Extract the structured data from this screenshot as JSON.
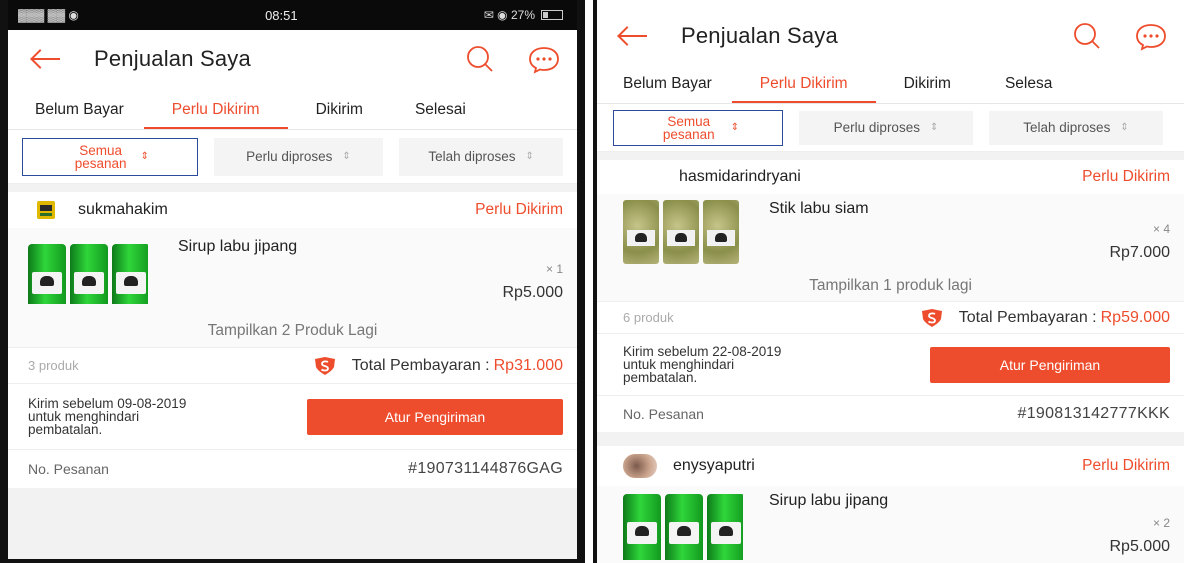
{
  "colors": {
    "accent": "#ee4d2d",
    "selected_border": "#2b4c9c"
  },
  "status_bar": {
    "left": "▓▓▓ ▓▓ ◉",
    "time": "08:51",
    "right": "✉ ◉ 27%"
  },
  "screens": [
    {
      "header": {
        "title": "Penjualan Saya",
        "icons": [
          "back-arrow-icon",
          "search-icon",
          "chat-icon"
        ]
      },
      "tabs": [
        "Belum Bayar",
        "Perlu Dikirim",
        "Dikirim",
        "Selesai"
      ],
      "active_tab": "Perlu Dikirim",
      "filters": [
        "Semua pesanan",
        "Perlu diproses",
        "Telah diproses"
      ],
      "orders": [
        {
          "shop": "sukmahakim",
          "status": "Perlu Dikirim",
          "product": "Sirup labu jipang",
          "qty": "× 1",
          "price": "Rp5.000",
          "more": "Tampilkan 2 Produk Lagi",
          "count": "3 produk",
          "total_label": "Total Pembayaran :",
          "total": "Rp31.000",
          "deadline": [
            "Kirim sebelum 09-08-2019",
            "untuk menghindari",
            "pembatalan."
          ],
          "ship_button": "Atur Pengiriman",
          "order_no_label": "No. Pesanan",
          "order_no": "#190731144876GAG"
        }
      ]
    },
    {
      "header": {
        "title": "Penjualan Saya",
        "icons": [
          "back-arrow-icon",
          "search-icon",
          "chat-icon"
        ]
      },
      "tabs": [
        "Belum Bayar",
        "Perlu Dikirim",
        "Dikirim",
        "Selesa"
      ],
      "active_tab": "Perlu Dikirim",
      "filters": [
        "Semua pesanan",
        "Perlu diproses",
        "Telah diproses"
      ],
      "orders": [
        {
          "shop": "hasmidarindryani",
          "status": "Perlu Dikirim",
          "product": "Stik labu siam",
          "qty": "× 4",
          "price": "Rp7.000",
          "more": "Tampilkan 1 produk lagi",
          "count": "6 produk",
          "total_label": "Total Pembayaran :",
          "total": "Rp59.000",
          "deadline": [
            "Kirim sebelum 22-08-2019",
            "untuk menghindari",
            "pembatalan."
          ],
          "ship_button": "Atur Pengiriman",
          "order_no_label": "No. Pesanan",
          "order_no": "#190813142777KKK"
        },
        {
          "shop": "enysyaputri",
          "status": "Perlu Dikirim",
          "product": "Sirup labu jipang",
          "qty": "× 2",
          "price": "Rp5.000"
        }
      ]
    }
  ]
}
